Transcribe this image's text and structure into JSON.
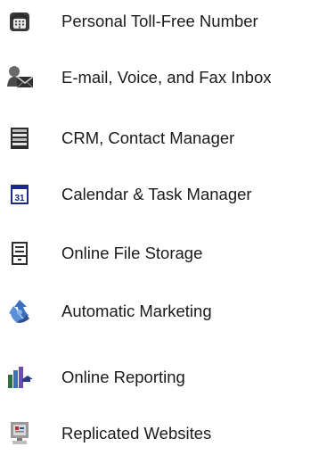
{
  "features": [
    {
      "label": "Personal Toll-Free Number",
      "icon": "telephone-icon"
    },
    {
      "label": "E-mail, Voice, and Fax Inbox",
      "icon": "inbox-person-envelope-icon"
    },
    {
      "label": "CRM, Contact Manager",
      "icon": "contact-list-icon"
    },
    {
      "label": "Calendar & Task Manager",
      "icon": "calendar-icon"
    },
    {
      "label": "Online File Storage",
      "icon": "file-cabinet-icon"
    },
    {
      "label": "Automatic Marketing",
      "icon": "recycle-arrows-icon"
    },
    {
      "label": "Online Reporting",
      "icon": "bar-chart-arrow-icon"
    },
    {
      "label": "Replicated Websites",
      "icon": "computer-monitor-icon"
    }
  ],
  "calendar_icon_text": "31"
}
